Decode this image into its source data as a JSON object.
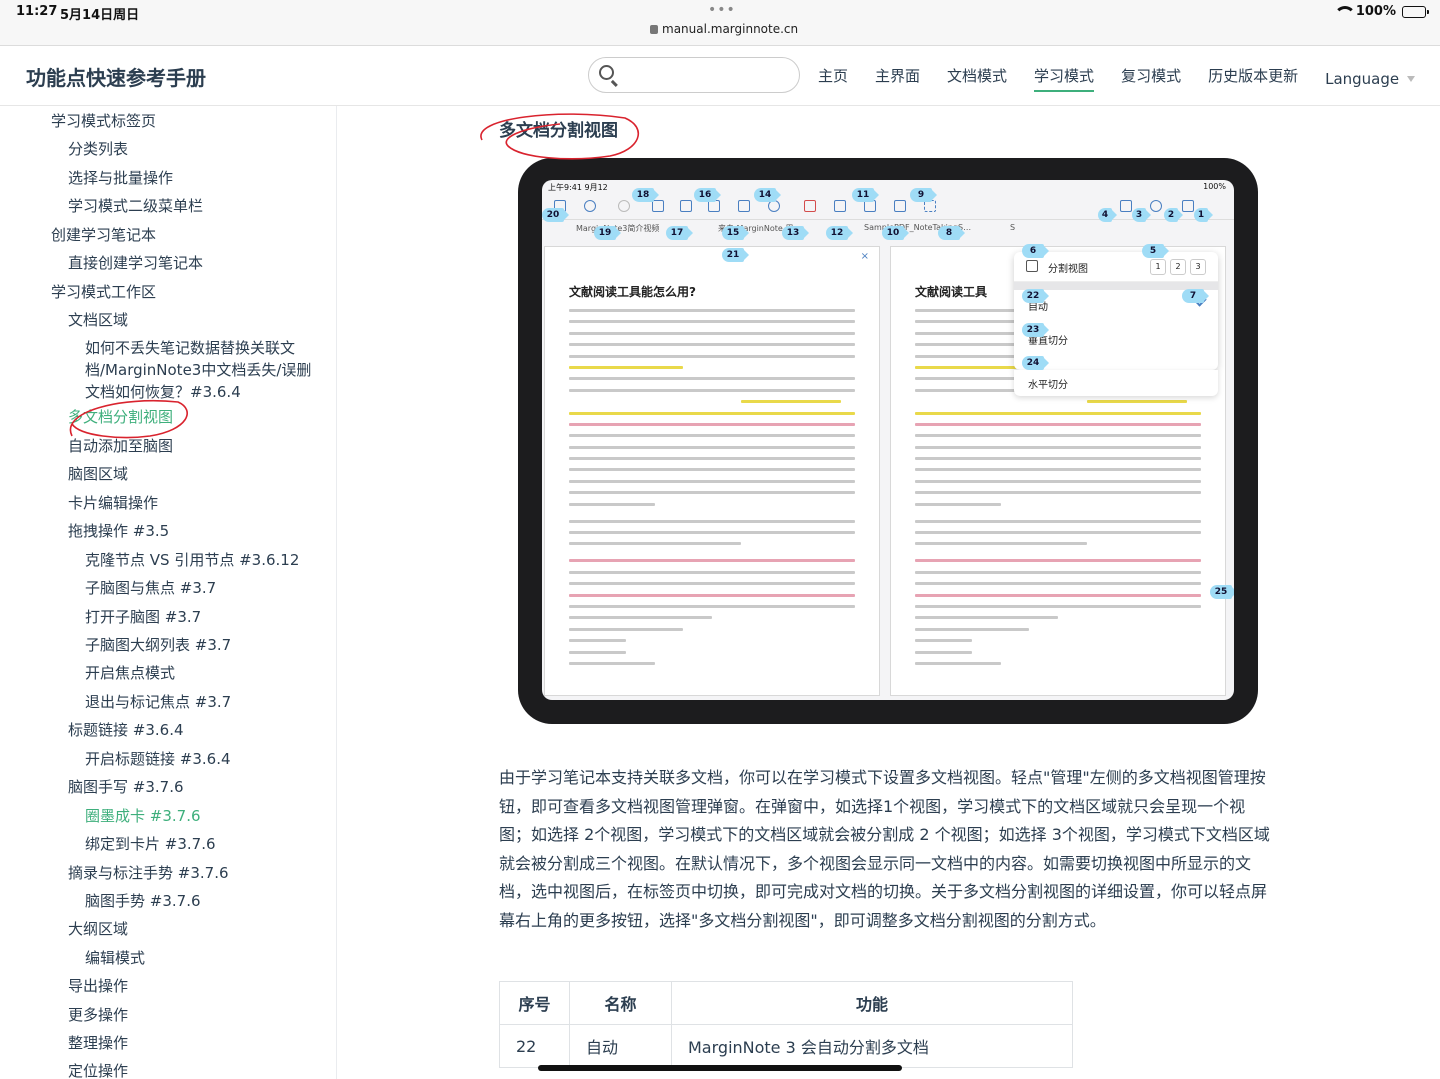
{
  "status": {
    "time": "11:27",
    "date": "5月14日周日",
    "url": "manual.marginnote.cn",
    "battery": "100%"
  },
  "header": {
    "title": "功能点快速参考手册",
    "search_placeholder": "",
    "nav": [
      "主页",
      "主界面",
      "文档模式",
      "学习模式",
      "复习模式",
      "历史版本更新"
    ],
    "language": "Language"
  },
  "sidebar": {
    "items": [
      "学习模式标签页",
      "分类列表",
      "选择与批量操作",
      "学习模式二级菜单栏",
      "创建学习笔记本",
      "直接创建学习笔记本",
      "学习模式工作区",
      "文档区域",
      "如何不丢失笔记数据替换关联文档/MarginNote3中文档丢失/误删文档如何恢复？#3.6.4",
      "多文档分割视图",
      "自动添加至脑图",
      "脑图区域",
      "卡片编辑操作",
      "拖拽操作 #3.5",
      "克隆节点 VS 引用节点 #3.6.12",
      "子脑图与焦点 #3.7",
      "打开子脑图 #3.7",
      "子脑图大纲列表 #3.7",
      "开启焦点模式",
      "退出与标记焦点 #3.7",
      "标题链接 #3.6.4",
      "开启标题链接 #3.6.4",
      "脑图手写 #3.7.6",
      "圈墨成卡 #3.7.6",
      "绑定到卡片 #3.7.6",
      "摘录与标注手势 #3.7.6",
      "脑图手势 #3.7.6",
      "大纲区域",
      "编辑模式",
      "导出操作",
      "更多操作",
      "整理操作",
      "定位操作"
    ]
  },
  "main": {
    "section_title": "多文档分割视图",
    "paragraph": "由于学习笔记本支持关联多文档，你可以在学习模式下设置多文档视图。轻点\"管理\"左侧的多文档视图管理按钮，即可查看多文档视图管理弹窗。在弹窗中，如选择1个视图，学习模式下的文档区域就只会呈现一个视图；如选择 2个视图，学习模式下的文档区域就会被分割成 2 个视图；如选择 3个视图，学习模式下文档区域就会被分割成三个视图。在默认情况下，多个视图会显示同一文档中的内容。如需要切换视图中所显示的文档，选中视图后，在标签页中切换，即可完成对文档的切换。关于多文档分割视图的详细设置，你可以轻点屏幕右上角的更多按钮，选择\"多文档分割视图\"，即可调整多文档分割视图的分割方式。",
    "table": {
      "headers": [
        "序号",
        "名称",
        "功能"
      ],
      "rows": [
        [
          "22",
          "自动",
          "MarginNote 3 会自动分割多文档"
        ]
      ]
    }
  },
  "figure": {
    "status_left": "上午9:41  9月12",
    "status_right": "100%",
    "tabs": [
      "MarginNote3简介视频",
      "来自 MarginNote 用…",
      "SamplePDF_NoteTakingS…",
      "S"
    ],
    "doc_title": "文献阅读工具能怎么用?",
    "doc_title_right": "文献阅读工具",
    "close": "×",
    "popup": {
      "title": "分割视图",
      "counts": [
        "1",
        "2",
        "3"
      ],
      "options": [
        "自动",
        "垂直切分",
        "水平切分"
      ]
    },
    "badges": [
      "20",
      "18",
      "16",
      "14",
      "11",
      "9",
      "4",
      "3",
      "2",
      "1",
      "19",
      "17",
      "15",
      "13",
      "12",
      "10",
      "8",
      "21",
      "6",
      "5",
      "22",
      "7",
      "23",
      "24",
      "25"
    ]
  }
}
